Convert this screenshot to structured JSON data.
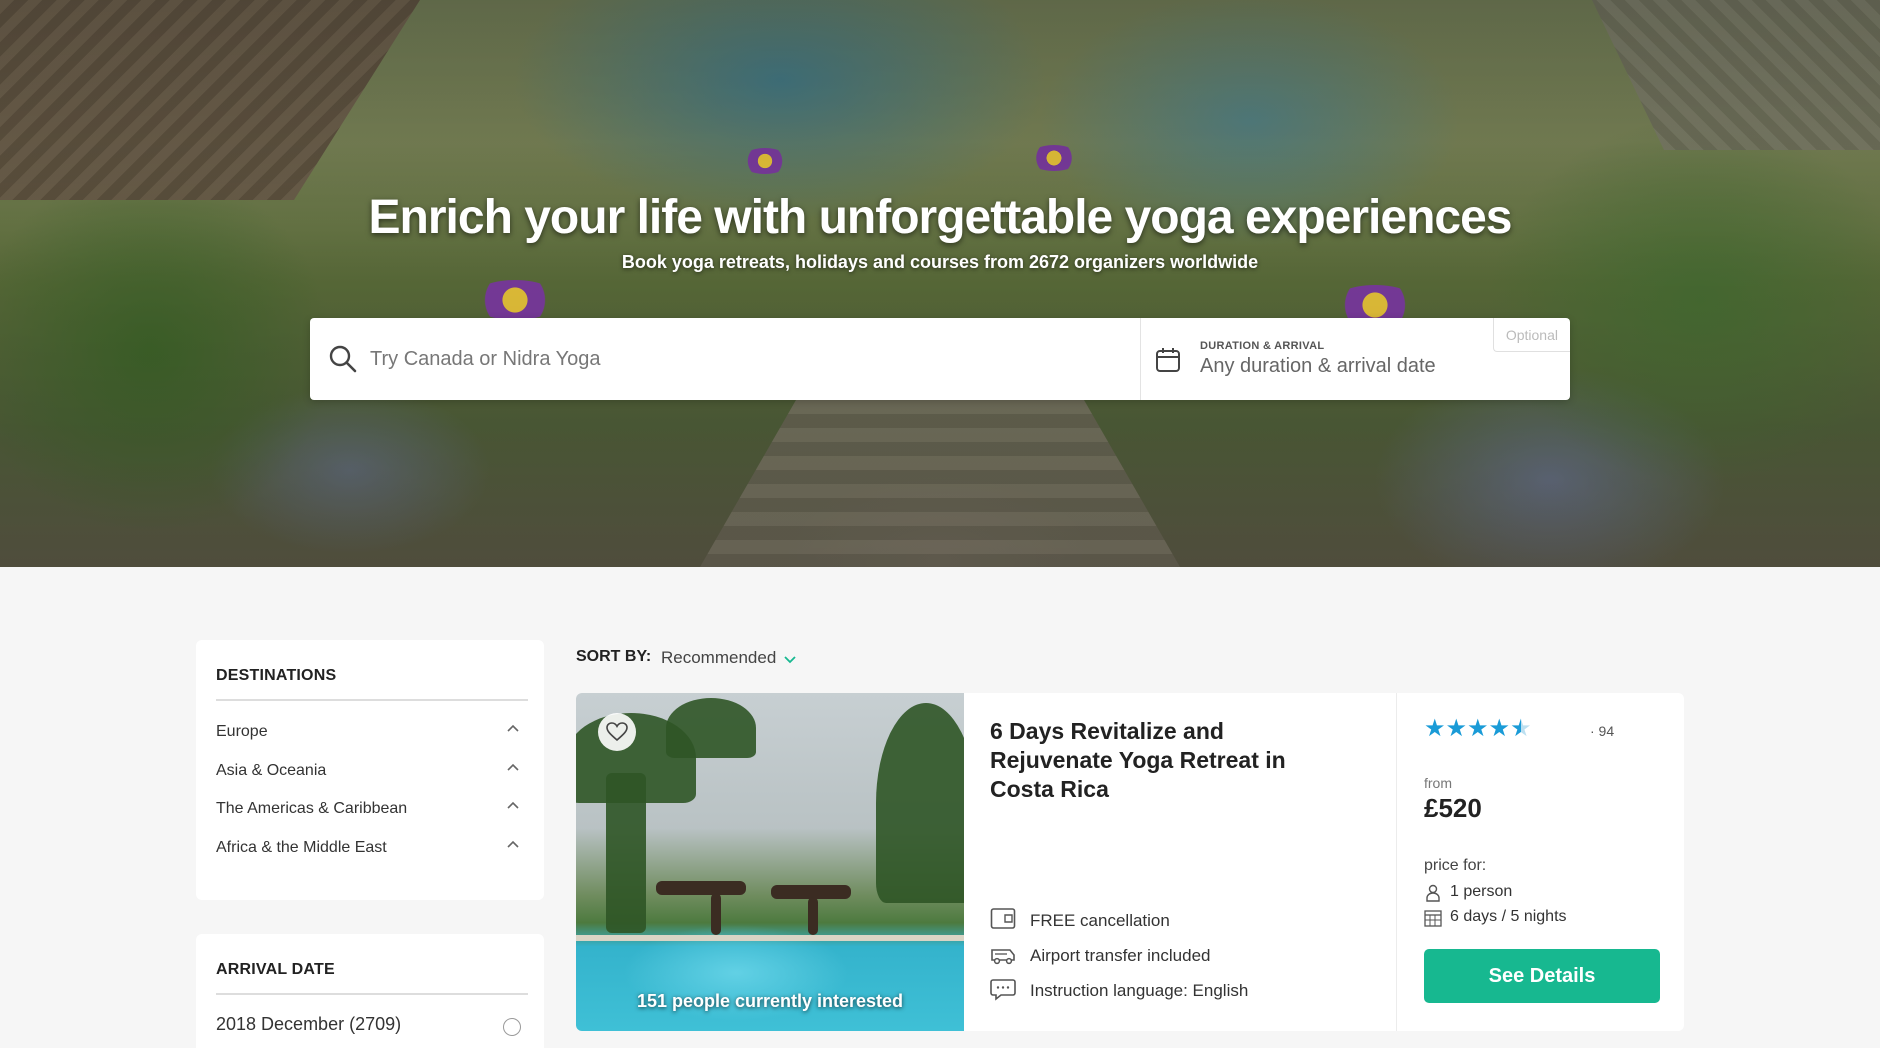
{
  "hero": {
    "title": "Enrich your life with unforgettable yoga experiences",
    "subtitle": "Book yoga retreats, holidays and courses from 2672 organizers worldwide"
  },
  "search": {
    "placeholder": "Try Canada or Nidra Yoga",
    "value": "",
    "icon": "search-icon",
    "duration_label": "DURATION & ARRIVAL",
    "duration_value": "Any duration & arrival date",
    "optional_tag": "Optional"
  },
  "sidebar": {
    "destinations": {
      "title": "DESTINATIONS",
      "items": [
        {
          "label": "Europe"
        },
        {
          "label": "Asia & Oceania"
        },
        {
          "label": "The Americas & Caribbean"
        },
        {
          "label": "Africa & the Middle East"
        }
      ]
    },
    "arrival": {
      "title": "ARRIVAL DATE",
      "items": [
        {
          "label": "2018 December (2709)"
        }
      ]
    }
  },
  "sort": {
    "label": "SORT BY:",
    "value": "Recommended"
  },
  "listing": {
    "interested": "151 people currently interested",
    "title": "6 Days Revitalize and Rejuvenate Yoga Retreat in Costa Rica",
    "features": [
      {
        "icon": "free-cancellation-icon",
        "label": "FREE cancellation"
      },
      {
        "icon": "airport-transfer-icon",
        "label": "Airport transfer included"
      },
      {
        "icon": "speech-bubble-icon",
        "label": "Instruction language: English"
      }
    ],
    "rating": 4.5,
    "reviews": "· 94",
    "from_label": "from",
    "price": "£520",
    "price_for_label": "price for:",
    "persons": "1 person",
    "duration": "6 days / 5 nights",
    "cta_label": "See Details"
  },
  "colors": {
    "accent": "#17b890",
    "star": "#1a9bd7"
  }
}
